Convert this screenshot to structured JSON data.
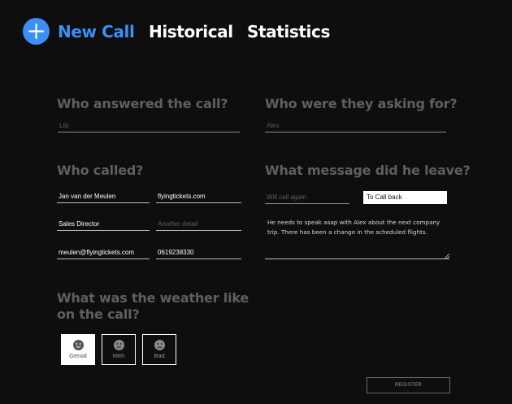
{
  "nav": {
    "add_icon": "plus-icon",
    "tabs": [
      {
        "label": "New Call",
        "active": true
      },
      {
        "label": "Historical",
        "active": false
      },
      {
        "label": "Statistics",
        "active": false
      }
    ]
  },
  "answered": {
    "heading": "Who answered the call?",
    "placeholder": "Lily",
    "value": ""
  },
  "asking_for": {
    "heading": "Who were they asking for?",
    "placeholder": "Alex",
    "value": ""
  },
  "caller": {
    "heading": "Who called?",
    "name": "Jan van der Meulen",
    "company": "flyingtickets.com",
    "title": "Sales Director",
    "extra_placeholder": "Another detail",
    "email": "meulen@flyingtickets.com",
    "phone": "0619238330"
  },
  "message": {
    "heading": "What message did he leave?",
    "callback_placeholder": "Will call again",
    "selected_option": "To Call back",
    "text": "He needs to speak asap with Alex about the next company trip. There has been a change in the scheduled flights."
  },
  "weather": {
    "heading": "What was the weather like on the call?",
    "options": [
      {
        "label": "Genial",
        "icon": "smile-icon",
        "selected": true
      },
      {
        "label": "Meh",
        "icon": "neutral-face-icon",
        "selected": false
      },
      {
        "label": "Bad",
        "icon": "sad-face-icon",
        "selected": false
      }
    ]
  },
  "register_label": "REGISTER",
  "colors": {
    "background": "#0e0e0e",
    "accent": "#3d8ef7",
    "heading": "#5f5f5f"
  }
}
